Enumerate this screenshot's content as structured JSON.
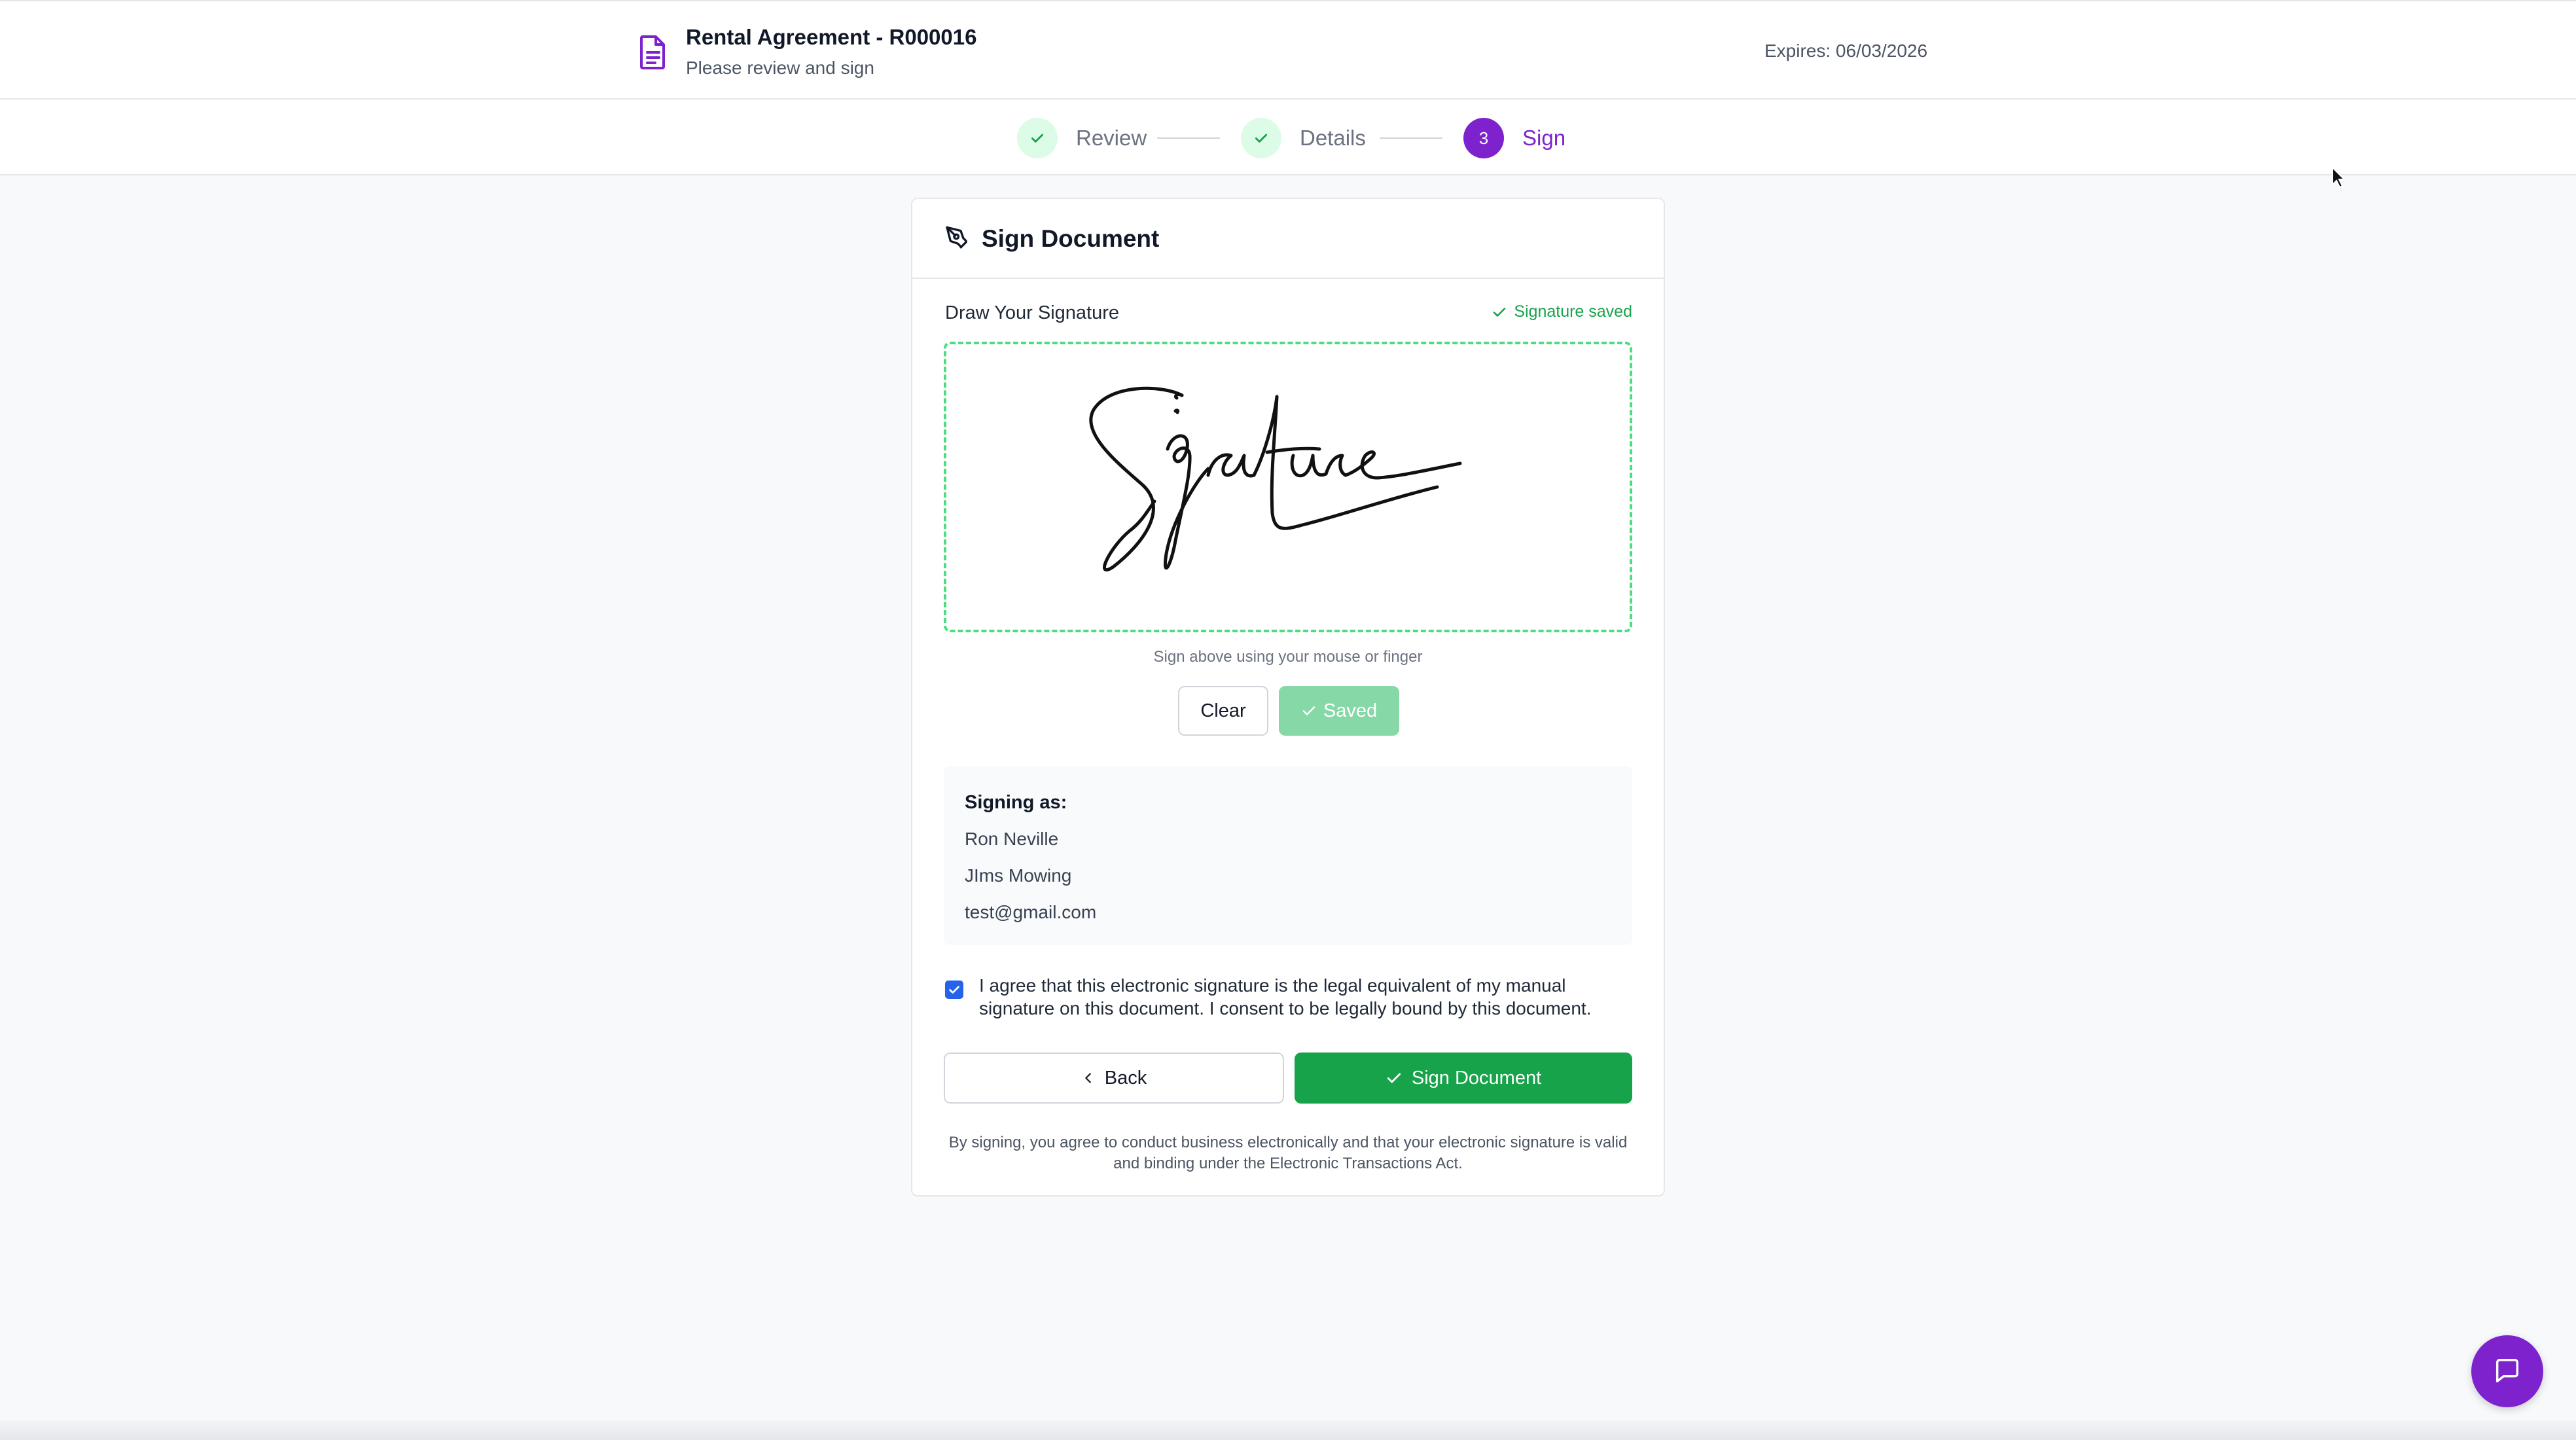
{
  "header": {
    "title": "Rental Agreement - R000016",
    "subtitle": "Please review and sign",
    "expires": "Expires: 06/03/2026",
    "icon": "document-icon"
  },
  "steps": [
    {
      "label": "Review",
      "state": "done"
    },
    {
      "label": "Details",
      "state": "done"
    },
    {
      "number": "3",
      "label": "Sign",
      "state": "active"
    }
  ],
  "card": {
    "title": "Sign Document",
    "draw_label": "Draw Your Signature",
    "saved_status": "Signature saved",
    "hint": "Sign above using your mouse or finger",
    "clear_label": "Clear",
    "saved_label": "Saved"
  },
  "signer": {
    "heading": "Signing as:",
    "name": "Ron Neville",
    "company": "JIms Mowing",
    "email": "test@gmail.com"
  },
  "agreement": {
    "checked": true,
    "text": "I agree that this electronic signature is the legal equivalent of my manual signature on this document. I consent to be legally bound by this document."
  },
  "actions": {
    "back_label": "Back",
    "sign_label": "Sign Document"
  },
  "legal": "By signing, you agree to conduct business electronically and that your electronic signature is valid and binding under the Electronic Transactions Act.",
  "colors": {
    "brand": "#7e22ce",
    "success": "#16a34a",
    "saved_button": "#86d9a6",
    "pad_border": "#4ade80"
  }
}
